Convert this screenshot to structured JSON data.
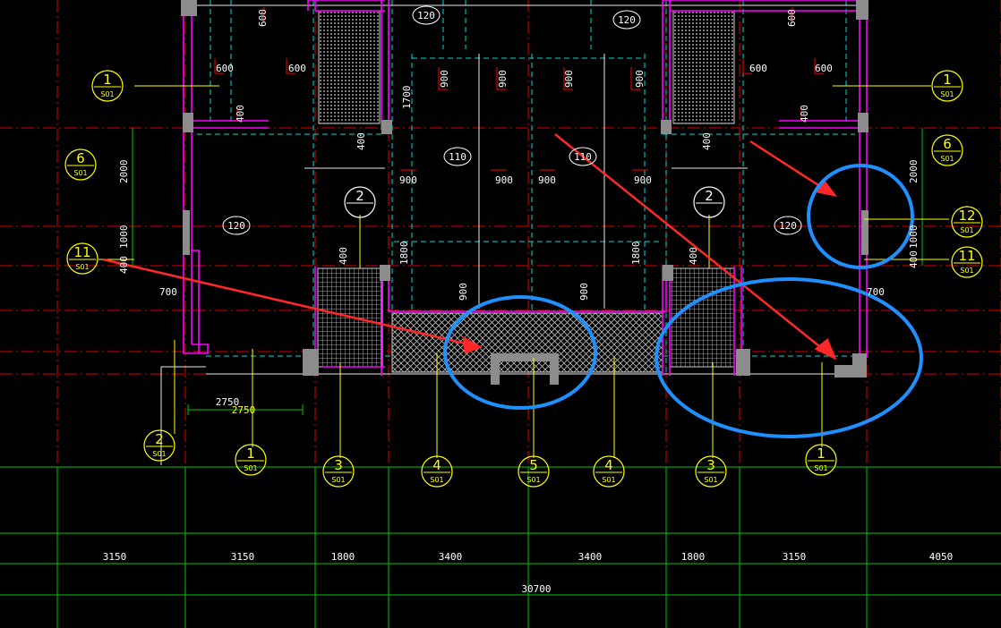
{
  "dimensions": {
    "bays": [
      "3150",
      "3150",
      "1800",
      "3400",
      "3400",
      "1800",
      "3150",
      "4050"
    ],
    "total": "30700",
    "detail_dim": "2750",
    "detail_dim_yellow": "2750"
  },
  "slab_labels": [
    "120",
    "120",
    "110",
    "110",
    "120",
    "120"
  ],
  "beam_labels": [
    "600",
    "600",
    "600",
    "600",
    "600",
    "600",
    "900",
    "900",
    "900",
    "900",
    "900",
    "900",
    "900",
    "900",
    "900",
    "900",
    "400",
    "400",
    "400",
    "400",
    "400",
    "400",
    "1700",
    "1800",
    "1800",
    "1000",
    "1000",
    "2000",
    "2000",
    "700",
    "700",
    "400",
    "400"
  ],
  "bubbles": [
    {
      "num": "1",
      "sub": "S01"
    },
    {
      "num": "6",
      "sub": "S01"
    },
    {
      "num": "11",
      "sub": "S01"
    },
    {
      "num": "2",
      "sub": ""
    },
    {
      "num": "2",
      "sub": ""
    },
    {
      "num": "1",
      "sub": "S01"
    },
    {
      "num": "6",
      "sub": "S01"
    },
    {
      "num": "12",
      "sub": "S01"
    },
    {
      "num": "11",
      "sub": "S01"
    },
    {
      "num": "2",
      "sub": "S01"
    },
    {
      "num": "1",
      "sub": "S01"
    },
    {
      "num": "3",
      "sub": "S01"
    },
    {
      "num": "4",
      "sub": "S01"
    },
    {
      "num": "5",
      "sub": "S01"
    },
    {
      "num": "4",
      "sub": "S01"
    },
    {
      "num": "3",
      "sub": "S01"
    },
    {
      "num": "1",
      "sub": "S01"
    }
  ],
  "colors": {
    "background": "#000000",
    "grid_red": "#ff0000",
    "grid_green": "#00ff00",
    "wall": "#ff00ff",
    "column": "#8c8c8c",
    "dashed": "#00ffff",
    "text": "#ffffff",
    "bubble": "#ffff00",
    "highlight": "#1e90ff",
    "arrow": "#ff2020"
  }
}
